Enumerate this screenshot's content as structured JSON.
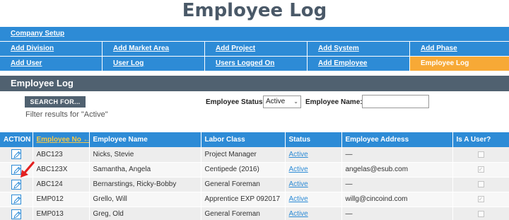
{
  "page": {
    "title": "Employee Log"
  },
  "nav": {
    "rows": [
      [
        {
          "label": "Company Setup",
          "width": 720
        }
      ],
      [
        {
          "label": "Add Division"
        },
        {
          "label": "Add Market Area"
        },
        {
          "label": "Add Project"
        },
        {
          "label": "Add System"
        },
        {
          "label": "Add Phase"
        }
      ],
      [
        {
          "label": "Add User"
        },
        {
          "label": "User Log"
        },
        {
          "label": "Users Logged On"
        },
        {
          "label": "Add Employee"
        },
        {
          "label": "Employee Log",
          "active": true
        }
      ]
    ]
  },
  "section": {
    "title": "Employee Log"
  },
  "filters": {
    "search_button": "SEARCH FOR...",
    "filter_note": "Filter results for \"Active\"",
    "status_label": "Employee Status:",
    "status_value": "Active",
    "name_label": "Employee Name:",
    "name_value": ""
  },
  "table": {
    "columns": [
      "ACTION",
      "Employee No",
      "Employee Name",
      "Labor Class",
      "Status",
      "Employee Address",
      "Is A User?"
    ],
    "sorted_column": "Employee No",
    "rows": [
      {
        "no": "ABC123",
        "name": "Nicks, Stevie",
        "labor": "Project Manager",
        "status": "Active",
        "address": "—",
        "is_user": false
      },
      {
        "no": "ABC123X",
        "name": "Samantha, Angela",
        "labor": "Centipede (2016)",
        "status": "Active",
        "address": "angelas@esub.com",
        "is_user": true
      },
      {
        "no": "ABC124",
        "name": "Bernarstings, Ricky-Bobby",
        "labor": "General Foreman",
        "status": "Active",
        "address": "—",
        "is_user": false
      },
      {
        "no": "EMP012",
        "name": "Grello, Will",
        "labor": "Apprentice EXP 092017",
        "status": "Active",
        "address": "willg@cincoind.com",
        "is_user": true
      },
      {
        "no": "EMP013",
        "name": "Greg, Old",
        "labor": "General Foreman",
        "status": "Active",
        "address": "—",
        "is_user": false
      }
    ]
  },
  "colors": {
    "nav_blue": "#2d8bd6",
    "accent_orange": "#f7a936",
    "header_slate": "#506170",
    "annotation_red": "#e32020"
  },
  "icons": {
    "edit": "pencil-icon",
    "annotation": "red-arrow-icon"
  }
}
